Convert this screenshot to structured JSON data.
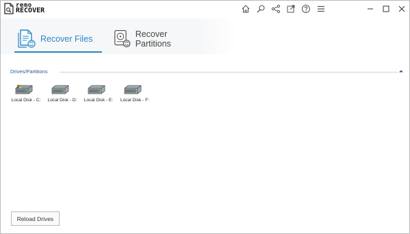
{
  "app": {
    "logo_line1": "remo",
    "logo_line2": "RECOVER"
  },
  "titlebar": {
    "icons": [
      "home-icon",
      "search-icon",
      "share-icon",
      "external-link-icon",
      "help-icon",
      "menu-icon"
    ],
    "controls": [
      "minimize-icon",
      "maximize-icon",
      "close-icon"
    ]
  },
  "tabs": {
    "recover_files": "Recover Files",
    "recover_partitions": "Recover Partitions",
    "active_color": "#2a86c8"
  },
  "drives_section": {
    "title": "Drives/Partitions",
    "drives": [
      {
        "label": "Local Disk - C:",
        "icon": "system-drive-icon"
      },
      {
        "label": "Local Disk - D:",
        "icon": "hard-drive-icon"
      },
      {
        "label": "Local Disk - E:",
        "icon": "hard-drive-icon"
      },
      {
        "label": "Local Disk - F:",
        "icon": "hard-drive-icon"
      }
    ]
  },
  "footer": {
    "reload_label": "Reload Drives"
  }
}
